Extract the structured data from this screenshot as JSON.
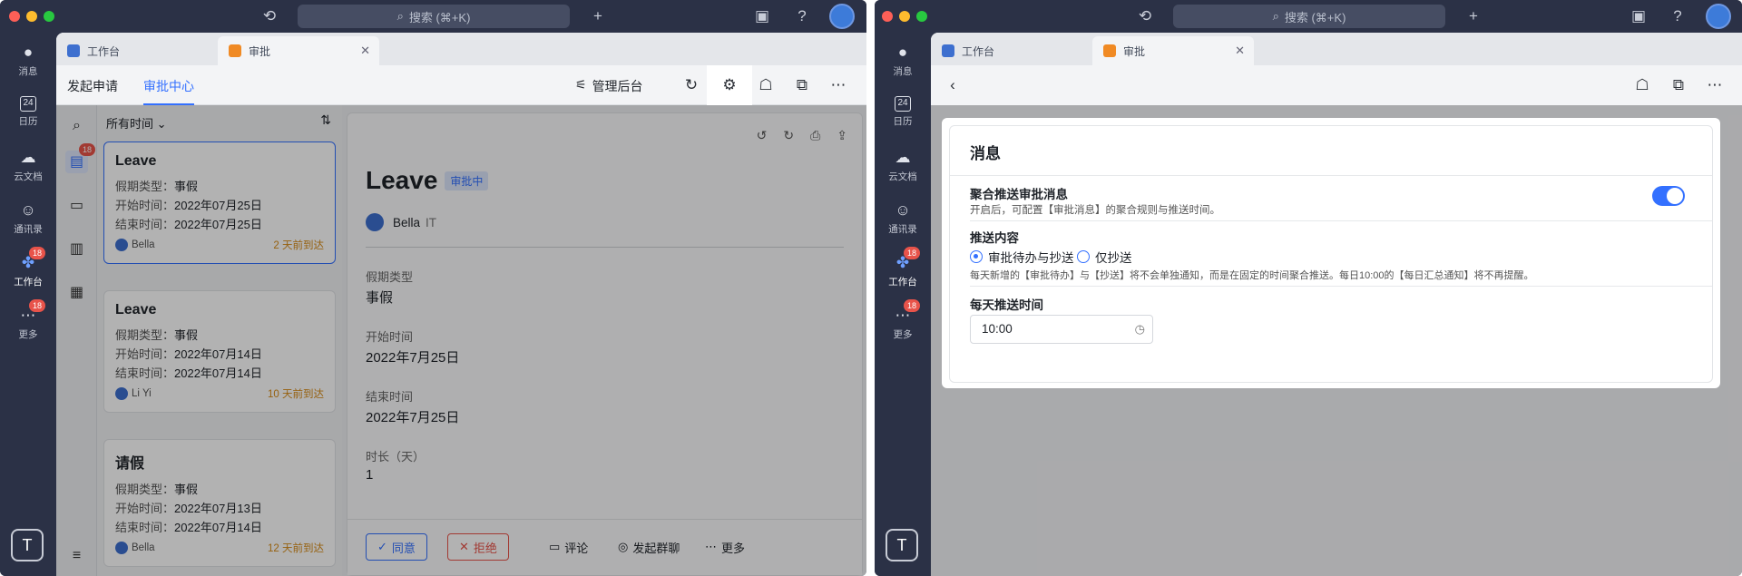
{
  "shared": {
    "search_placeholder": "搜索 (⌘+K)",
    "nav": [
      {
        "label": "消息",
        "icon": "chat-bubble-icon"
      },
      {
        "label": "日历",
        "icon": "calendar-icon",
        "num": "24"
      },
      {
        "label": "云文档",
        "icon": "cloud-doc-icon"
      },
      {
        "label": "通讯录",
        "icon": "contacts-icon"
      },
      {
        "label": "工作台",
        "icon": "workplace-icon",
        "badge": "18"
      },
      {
        "label": "更多",
        "icon": "more-icon",
        "badge": "18"
      }
    ],
    "bottom_logo": "T",
    "tabs": [
      {
        "label": "工作台"
      },
      {
        "label": "审批"
      }
    ],
    "colors": {
      "accent": "#3370ff",
      "badge": "#e8534a",
      "sidebar": "#2b3146"
    }
  },
  "left": {
    "toolbar": {
      "tab_submit": "发起申请",
      "tab_center": "审批中心",
      "admin": "管理后台"
    },
    "filter": "所有时间",
    "sub_badge": "18",
    "cards": [
      {
        "title": "Leave",
        "type_label": "假期类型：",
        "type": "事假",
        "start_label": "开始时间：",
        "start": "2022年07月25日",
        "end_label": "结束时间：",
        "end": "2022年07月25日",
        "user": "Bella",
        "ago": "2 天前到达"
      },
      {
        "title": "Leave",
        "type_label": "假期类型：",
        "type": "事假",
        "start_label": "开始时间：",
        "start": "2022年07月14日",
        "end_label": "结束时间：",
        "end": "2022年07月14日",
        "user": "Li Yi",
        "ago": "10 天前到达"
      },
      {
        "title": "请假",
        "type_label": "假期类型：",
        "type": "事假",
        "start_label": "开始时间：",
        "start": "2022年07月13日",
        "end_label": "结束时间：",
        "end": "2022年07月14日",
        "user": "Bella",
        "ago": "12 天前到达"
      }
    ],
    "detail": {
      "title": "Leave",
      "status": "审批中",
      "user": "Bella",
      "dept": "IT",
      "fields": [
        {
          "label": "假期类型",
          "value": "事假"
        },
        {
          "label": "开始时间",
          "value": "2022年7月25日"
        },
        {
          "label": "结束时间",
          "value": "2022年7月25日"
        },
        {
          "label": "时长（天）",
          "value": "1"
        }
      ],
      "actions": {
        "approve": "同意",
        "reject": "拒绝",
        "comment": "评论",
        "group": "发起群聊",
        "more": "更多"
      }
    }
  },
  "right": {
    "panel": {
      "heading": "消息",
      "s1_title": "聚合推送审批消息",
      "s1_desc": "开启后，可配置【审批消息】的聚合规则与推送时间。",
      "s1_toggle": true,
      "s2_title": "推送内容",
      "opt1": "审批待办与抄送",
      "opt2": "仅抄送",
      "selected": "审批待办与抄送",
      "s2_desc": "每天新增的【审批待办】与【抄送】将不会单独通知，而是在固定的时间聚合推送。每日10:00的【每日汇总通知】将不再提醒。",
      "s3_title": "每天推送时间",
      "time": "10:00"
    }
  }
}
